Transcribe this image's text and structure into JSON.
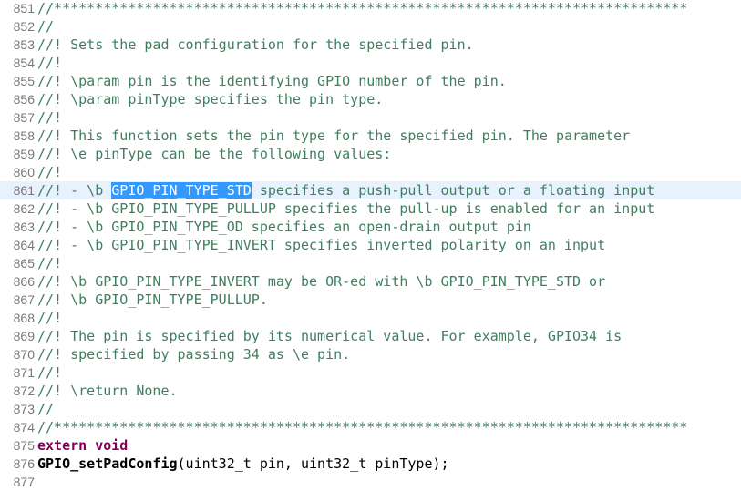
{
  "editor": {
    "lines": [
      {
        "n": "851",
        "parts": [
          {
            "t": "//*****************************************************************************",
            "k": "comment"
          }
        ]
      },
      {
        "n": "852",
        "parts": [
          {
            "t": "//",
            "k": "comment"
          }
        ]
      },
      {
        "n": "853",
        "parts": [
          {
            "t": "//! Sets the pad configuration for the specified pin.",
            "k": "comment"
          }
        ]
      },
      {
        "n": "854",
        "parts": [
          {
            "t": "//!",
            "k": "comment"
          }
        ]
      },
      {
        "n": "855",
        "parts": [
          {
            "t": "//! \\param pin is the identifying GPIO number of the pin.",
            "k": "comment"
          }
        ]
      },
      {
        "n": "856",
        "parts": [
          {
            "t": "//! \\param pinType specifies the pin type.",
            "k": "comment"
          }
        ]
      },
      {
        "n": "857",
        "parts": [
          {
            "t": "//!",
            "k": "comment"
          }
        ]
      },
      {
        "n": "858",
        "parts": [
          {
            "t": "//! This function sets the pin type for the specified pin. The parameter",
            "k": "comment"
          }
        ]
      },
      {
        "n": "859",
        "parts": [
          {
            "t": "//! \\e pinType can be the following values:",
            "k": "comment"
          }
        ]
      },
      {
        "n": "860",
        "parts": [
          {
            "t": "//!",
            "k": "comment"
          }
        ]
      },
      {
        "n": "861",
        "current": true,
        "parts": [
          {
            "t": "//! - \\b ",
            "k": "comment"
          },
          {
            "t": "GPIO_PIN_TYPE_STD",
            "k": "selected"
          },
          {
            "t": " specifies a push-pull output or a floating input",
            "k": "comment"
          }
        ]
      },
      {
        "n": "862",
        "parts": [
          {
            "t": "//! - \\b GPIO_PIN_TYPE_PULLUP specifies the pull-up is enabled for an input",
            "k": "comment"
          }
        ]
      },
      {
        "n": "863",
        "parts": [
          {
            "t": "//! - \\b GPIO_PIN_TYPE_OD specifies an open-drain output pin",
            "k": "comment"
          }
        ]
      },
      {
        "n": "864",
        "parts": [
          {
            "t": "//! - \\b GPIO_PIN_TYPE_INVERT specifies inverted polarity on an input",
            "k": "comment"
          }
        ]
      },
      {
        "n": "865",
        "parts": [
          {
            "t": "//!",
            "k": "comment"
          }
        ]
      },
      {
        "n": "866",
        "parts": [
          {
            "t": "//! \\b GPIO_PIN_TYPE_INVERT may be OR-ed with \\b GPIO_PIN_TYPE_STD or",
            "k": "comment"
          }
        ]
      },
      {
        "n": "867",
        "parts": [
          {
            "t": "//! \\b GPIO_PIN_TYPE_PULLUP.",
            "k": "comment"
          }
        ]
      },
      {
        "n": "868",
        "parts": [
          {
            "t": "//!",
            "k": "comment"
          }
        ]
      },
      {
        "n": "869",
        "parts": [
          {
            "t": "//! The pin is specified by its numerical value. For example, GPIO34 is",
            "k": "comment"
          }
        ]
      },
      {
        "n": "870",
        "parts": [
          {
            "t": "//! specified by passing 34 as \\e pin.",
            "k": "comment"
          }
        ]
      },
      {
        "n": "871",
        "parts": [
          {
            "t": "//!",
            "k": "comment"
          }
        ]
      },
      {
        "n": "872",
        "parts": [
          {
            "t": "//! \\return None.",
            "k": "comment"
          }
        ]
      },
      {
        "n": "873",
        "parts": [
          {
            "t": "//",
            "k": "comment"
          }
        ]
      },
      {
        "n": "874",
        "parts": [
          {
            "t": "//*****************************************************************************",
            "k": "comment"
          }
        ]
      },
      {
        "n": "875",
        "parts": [
          {
            "t": "extern void",
            "k": "keyword"
          }
        ]
      },
      {
        "n": "876",
        "parts": [
          {
            "t": "GPIO_setPadConfig",
            "k": "func"
          },
          {
            "t": "(uint32_t pin, uint32_t pinType);",
            "k": "plain"
          }
        ]
      },
      {
        "n": "877",
        "parts": []
      }
    ]
  },
  "colors": {
    "comment": "#3f7f5f",
    "keyword": "#7f0055",
    "line_number": "#787878",
    "selection": "#3399ff",
    "current_line": "#e8f2fe"
  }
}
